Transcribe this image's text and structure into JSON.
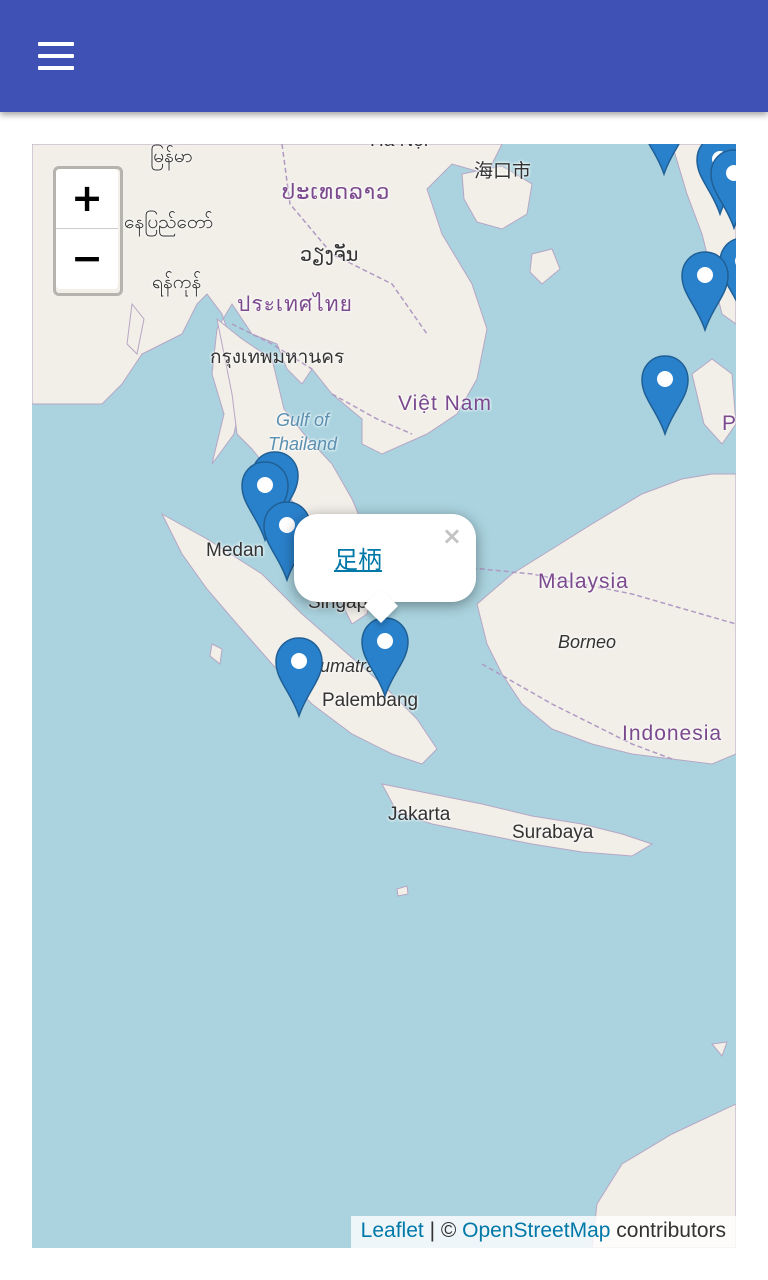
{
  "appbar": {
    "menu_icon": "hamburger-menu-icon",
    "color": "#3f51b5"
  },
  "map": {
    "zoom_in_label": "+",
    "zoom_out_label": "−",
    "labels": {
      "myanmar": "မြန်မာ",
      "naypyidaw": "နေပြည်တော်",
      "yangon": "ရန်ကုန်",
      "laos": "ປະເທດລາວ",
      "vientiane": "ວຽງຈັນ",
      "thailand": "ประเทศไทย",
      "bangkok": "กรุงเทพมหานคร",
      "hanoi": "Hà Nội",
      "haikou": "海口市",
      "vietnam": "Việt Nam",
      "gulf1": "Gulf of",
      "gulf2": "Thailand",
      "medan": "Medan",
      "singapore": "Singapore",
      "malaysia": "Malaysia",
      "borneo": "Borneo",
      "sumatra": "Sumatra",
      "palembang": "Palembang",
      "indonesia": "Indonesia",
      "jakarta": "Jakarta",
      "surabaya": "Surabaya",
      "philippines_cut": "P"
    },
    "popup": {
      "link_text": "足柄",
      "close_label": "×"
    },
    "attribution": {
      "leaflet": "Leaflet",
      "separator": " | © ",
      "osm": "OpenStreetMap",
      "suffix": " contributors"
    },
    "colors": {
      "water": "#aad3df",
      "land": "#f2efe9",
      "marker": "#2a81cb"
    }
  }
}
